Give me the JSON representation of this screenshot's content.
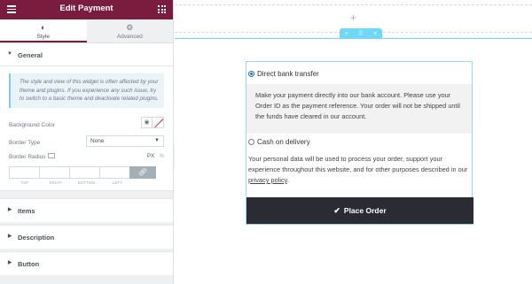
{
  "panel": {
    "title": "Edit Payment",
    "tabs": [
      {
        "label": "Style",
        "icon": "half-circle-icon"
      },
      {
        "label": "Advanced",
        "icon": "gear-icon"
      }
    ],
    "general": {
      "heading": "General",
      "note": "The style and view of this widget is often affected by your theme and plugins. If you experience any such issue, try to switch to a basic theme and deactivate related plugins.",
      "background_color_label": "Background Color",
      "border_type_label": "Border Type",
      "border_type_value": "None",
      "border_radius_label": "Border Radius",
      "units": [
        "PX",
        "%"
      ],
      "dimension_labels": [
        "TOP",
        "RIGHT",
        "BOTTOM",
        "LEFT"
      ]
    },
    "collapsed_sections": [
      "Items",
      "Description",
      "Button"
    ]
  },
  "canvas": {
    "add_section_symbol": "+",
    "section_handle": [
      "+",
      "⠿",
      "×"
    ],
    "payment": {
      "option1_label": "Direct bank transfer",
      "option1_description": "Make your payment directly into our bank account. Please use your Order ID as the payment reference. Your order will not be shipped until the funds have cleared in our account.",
      "option2_label": "Cash on delivery",
      "privacy_text": "Your personal data will be used to process your order, support your experience throughout this website, and for other purposes described in our",
      "privacy_link": "privacy policy",
      "privacy_end": ".",
      "button_label": "Place Order"
    }
  },
  "colors": {
    "header": "#7a1c3d",
    "section_accent": "#71d7f7",
    "button": "#2b2c33"
  }
}
